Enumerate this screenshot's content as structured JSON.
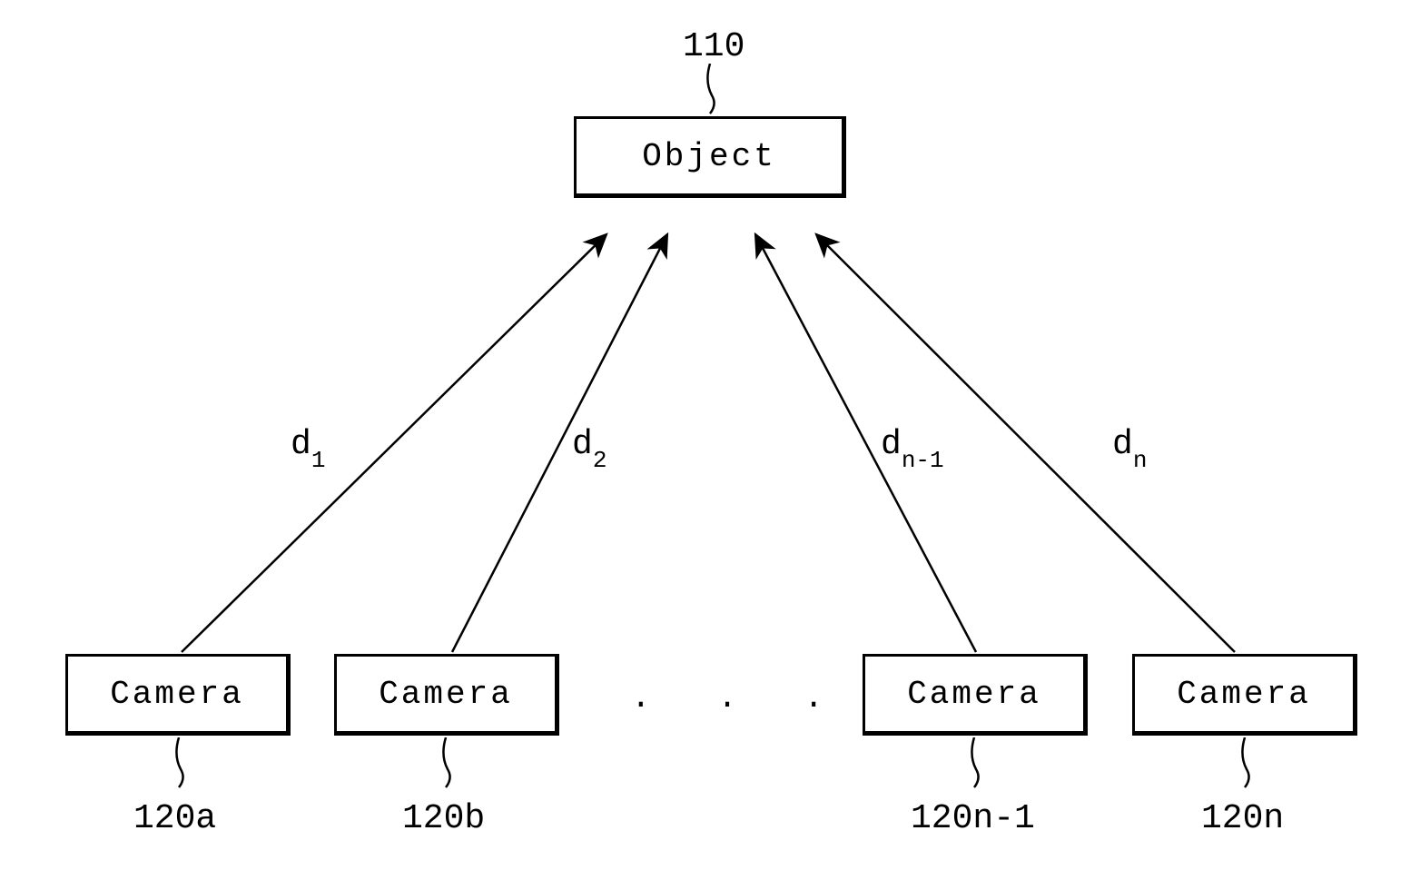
{
  "object": {
    "ref_label": "110",
    "box_label": "Object"
  },
  "distances": {
    "d1": "d",
    "d1_sub": "1",
    "d2": "d",
    "d2_sub": "2",
    "dn1": "d",
    "dn1_sub": "n-1",
    "dn": "d",
    "dn_sub": "n"
  },
  "cameras": {
    "c1_label": "Camera",
    "c1_ref": "120a",
    "c2_label": "Camera",
    "c2_ref": "120b",
    "c3_label": "Camera",
    "c3_ref": "120n-1",
    "c4_label": "Camera",
    "c4_ref": "120n"
  },
  "ellipsis": ". . ."
}
